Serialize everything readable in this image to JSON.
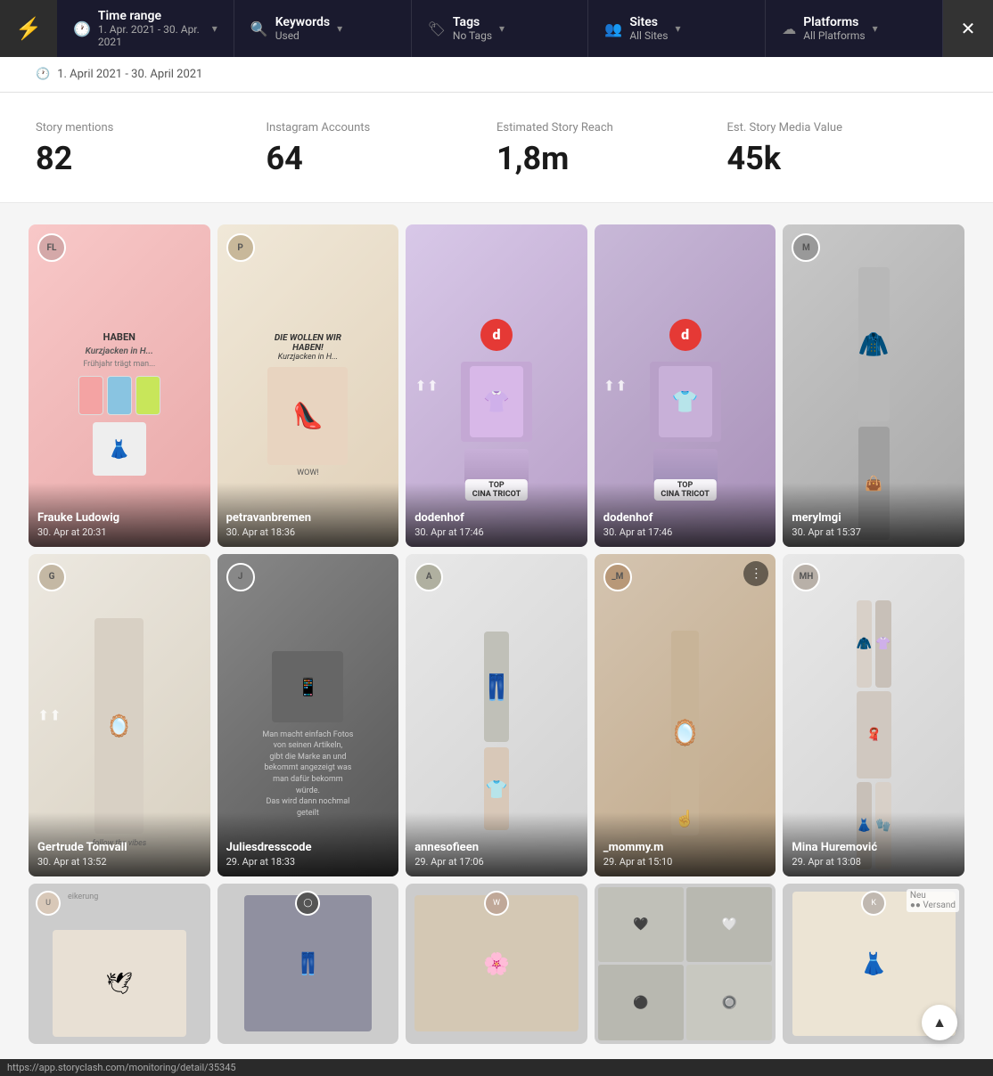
{
  "filterBar": {
    "logo": "⚡",
    "items": [
      {
        "icon": "🕐",
        "label": "Time range",
        "value": "1. Apr. 2021 - 30. Apr. 2021",
        "hasDropdown": true
      },
      {
        "icon": "🔍",
        "label": "Keywords",
        "value": "Used",
        "hasDropdown": true
      },
      {
        "icon": "🏷",
        "label": "Tags",
        "value": "No Tags",
        "hasDropdown": true
      },
      {
        "icon": "👥",
        "label": "Sites",
        "value": "All Sites",
        "hasDropdown": true
      },
      {
        "icon": "☁",
        "label": "Platforms",
        "value": "All Platforms",
        "hasDropdown": true
      }
    ],
    "closeBtn": "✕"
  },
  "dateSubtitle": {
    "icon": "🕐",
    "text": "1. April 2021 - 30. April 2021"
  },
  "stats": [
    {
      "label": "Story mentions",
      "value": "82"
    },
    {
      "label": "Instagram Accounts",
      "value": "64"
    },
    {
      "label": "Estimated Story Reach",
      "value": "1,8m"
    },
    {
      "label": "Est. Story Media Value",
      "value": "45k"
    }
  ],
  "gallery": {
    "rows": [
      {
        "cards": [
          {
            "id": "card-1",
            "username": "Frauke Ludowig",
            "date": "30. Apr at 20:31",
            "bgClass": "bg-pink",
            "hasAvatar": true,
            "avatarInitial": "FL",
            "platformType": "instagram",
            "hasTop": false
          },
          {
            "id": "card-2",
            "username": "petravanbremen",
            "date": "30. Apr at 18:36",
            "bgClass": "bg-beige",
            "hasAvatar": true,
            "avatarInitial": "P",
            "platformType": "instagram",
            "hasTop": false
          },
          {
            "id": "card-3",
            "username": "dodenhof",
            "date": "30. Apr at 17:46",
            "bgClass": "bg-purple",
            "hasAvatar": false,
            "platformType": "dodenhof",
            "hasTop": true,
            "topText": "CINA TRICOT"
          },
          {
            "id": "card-4",
            "username": "dodenhof",
            "date": "30. Apr at 17:46",
            "bgClass": "bg-purple2",
            "hasAvatar": false,
            "platformType": "dodenhof",
            "hasTop": true,
            "topText": "CINA TRICOT"
          },
          {
            "id": "card-5",
            "username": "merylmgi",
            "date": "30. Apr at 15:37",
            "bgClass": "bg-gray",
            "hasAvatar": true,
            "avatarInitial": "M",
            "platformType": "instagram",
            "hasTop": false
          }
        ]
      },
      {
        "cards": [
          {
            "id": "card-6",
            "username": "Gertrude Tomvall",
            "date": "30. Apr at 13:52",
            "bgClass": "bg-cream",
            "hasAvatar": true,
            "avatarInitial": "G",
            "platformType": "instagram",
            "hasTop": false,
            "hasCarousel": true
          },
          {
            "id": "card-7",
            "username": "Juliesdresscode",
            "date": "29. Apr at 18:33",
            "bgClass": "bg-dark",
            "hasAvatar": true,
            "avatarInitial": "J",
            "platformType": "instagram",
            "hasTop": false
          },
          {
            "id": "card-8",
            "username": "annesofieen",
            "date": "29. Apr at 17:06",
            "bgClass": "bg-lightgray",
            "hasAvatar": true,
            "avatarInitial": "A",
            "platformType": "instagram",
            "hasTop": false
          },
          {
            "id": "card-9",
            "username": "_mommy.m",
            "date": "29. Apr at 15:10",
            "bgClass": "bg-tan",
            "hasAvatar": true,
            "avatarInitial": "_M",
            "platformType": "instagram",
            "hasTop": false,
            "hasMenu": true
          },
          {
            "id": "card-10",
            "username": "Mina Huremović",
            "date": "29. Apr at 13:08",
            "bgClass": "bg-lightgray",
            "hasAvatar": true,
            "avatarInitial": "MH",
            "platformType": "instagram",
            "hasTop": false
          }
        ]
      }
    ],
    "partialRow": {
      "cards": [
        {
          "id": "partial-1",
          "bgClass": "bg-cream",
          "hasAvatar": true,
          "avatarInitial": "U"
        },
        {
          "id": "partial-2",
          "bgClass": "bg-mixed"
        },
        {
          "id": "partial-3",
          "bgClass": "bg-beige"
        },
        {
          "id": "partial-4",
          "bgClass": "bg-lightgray"
        },
        {
          "id": "partial-5",
          "bgClass": "bg-cream"
        }
      ]
    }
  },
  "scrollTopBtn": "▲",
  "statusBar": {
    "url": "https://app.storyclash.com/monitoring/detail/35345"
  }
}
